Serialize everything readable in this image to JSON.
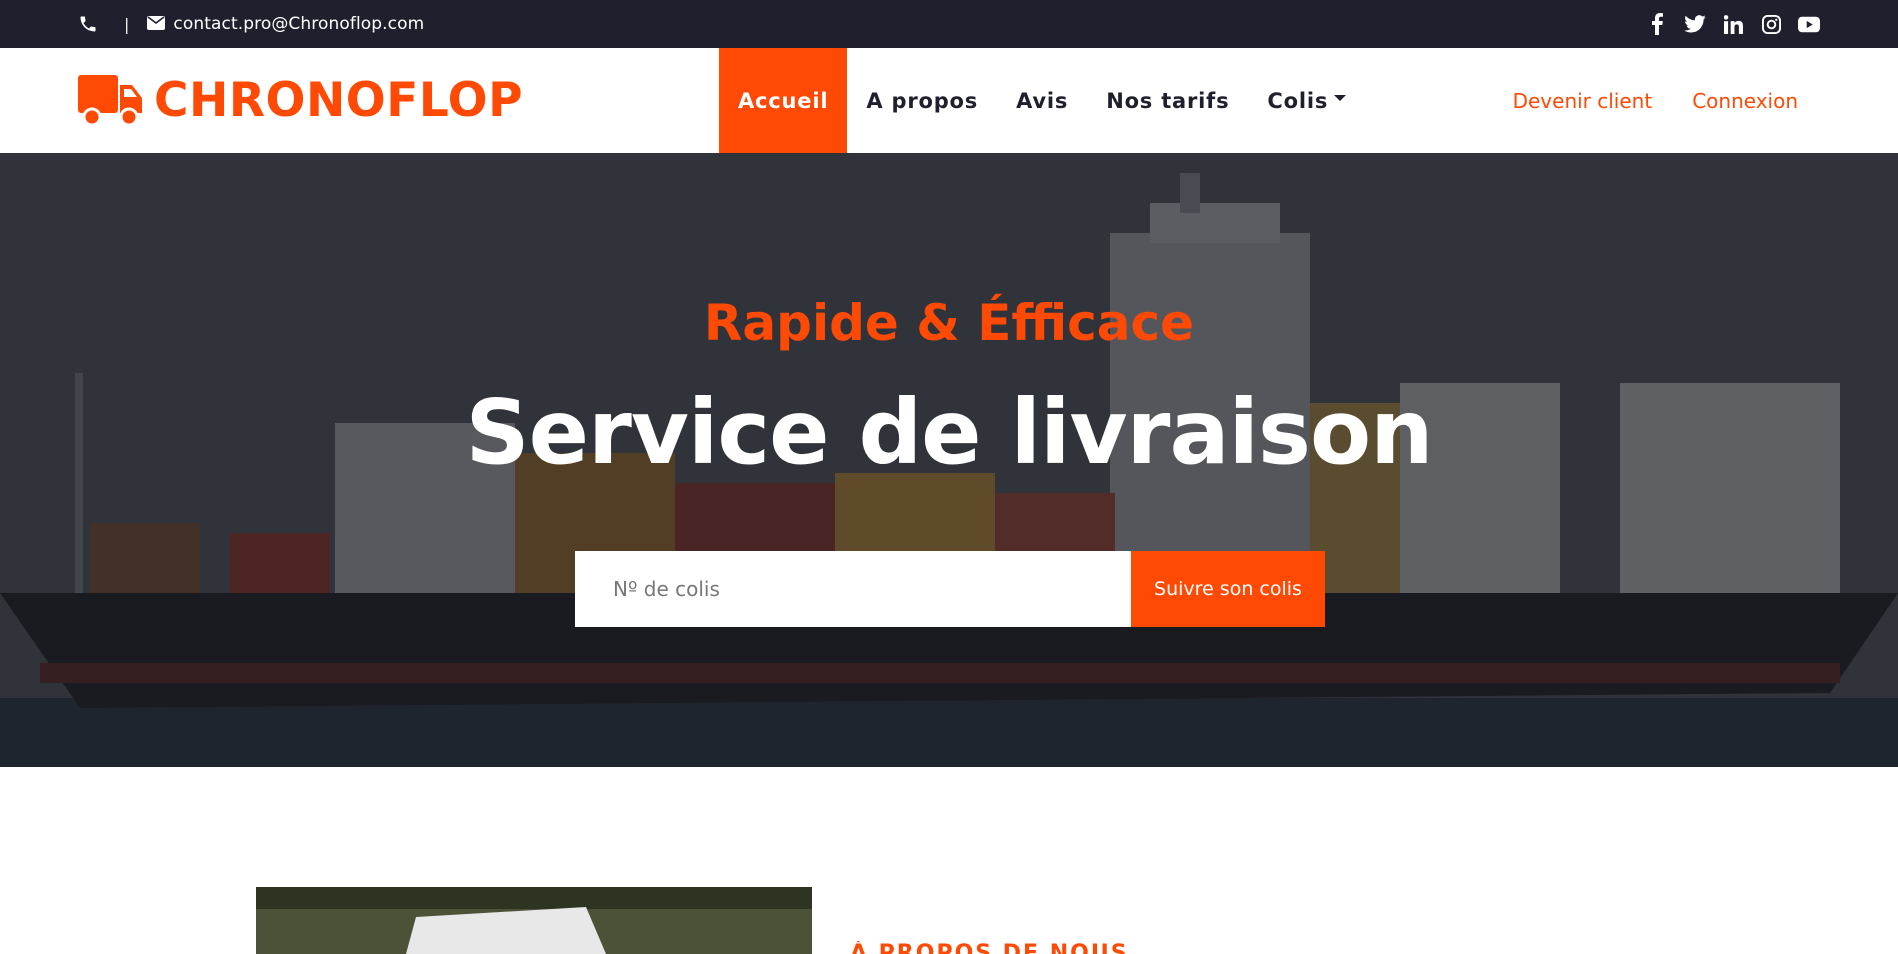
{
  "topbar": {
    "email": "contact.pro@Chronoflop.com",
    "separator": "|",
    "icons": [
      "phone-icon",
      "envelope-icon"
    ],
    "socials": [
      "facebook-icon",
      "twitter-icon",
      "linkedin-icon",
      "instagram-icon",
      "youtube-icon"
    ]
  },
  "navbar": {
    "brand": "CHRONOFLOP",
    "brand_icon": "truck-icon",
    "items": [
      {
        "label": "Accueil",
        "active": true
      },
      {
        "label": "A propos"
      },
      {
        "label": "Avis"
      },
      {
        "label": "Nos tarifs"
      },
      {
        "label": "Colis",
        "dropdown": true
      }
    ],
    "right": {
      "signup": "Devenir client",
      "login": "Connexion"
    }
  },
  "hero": {
    "subtitle": "Rapide & Éfficace",
    "title": "Service de livraison",
    "search_placeholder": "Nº de colis",
    "search_button": "Suivre son colis"
  },
  "about": {
    "kicker": "À PROPOS DE NOUS"
  },
  "colors": {
    "accent": "#ff4a06",
    "dark": "#1f1f2e",
    "white": "#ffffff"
  }
}
